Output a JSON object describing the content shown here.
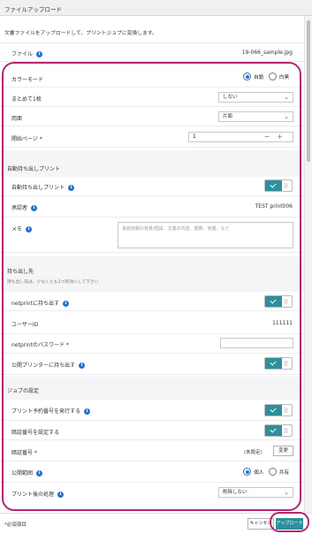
{
  "window": {
    "title": "ファイルアップロード"
  },
  "intro": "文書ファイルをアップロードして、プリントジョブに変換します。",
  "file": {
    "label": "ファイル",
    "value": "19-066_sample.jpg"
  },
  "colorMode": {
    "label": "カラーモード",
    "options": [
      "自動",
      "白黒"
    ],
    "selected": "自動"
  },
  "nup": {
    "label": "まとめて1枚",
    "value": "しない"
  },
  "duplex": {
    "label": "両面",
    "value": "片面"
  },
  "startPage": {
    "label": "開始ページ *",
    "value": "1"
  },
  "autoSection": {
    "title": "自動持ち出しプリント",
    "autoPrint": {
      "label": "自動持ち出しプリント",
      "on": true
    },
    "approver": {
      "label": "承認者",
      "value": "TEST print006"
    },
    "memo": {
      "label": "メモ",
      "placeholder": "承認依頼の背景/理由、文書の内容、部数、宛書、など"
    }
  },
  "takeoutSection": {
    "title": "持ち出し先",
    "note": "持ち出し先は、少なくとも1つ有効にして下さい",
    "netprint": {
      "label": "netprintに持ち出す",
      "on": true
    },
    "userId": {
      "label": "ユーザーID",
      "value": "111111"
    },
    "password": {
      "label": "netprintのパスワード *"
    },
    "public": {
      "label": "公開プリンターに持ち出す",
      "on": true
    }
  },
  "jobSection": {
    "title": "ジョブの設定",
    "reserve": {
      "label": "プリント予約番号を発行する",
      "on": true
    },
    "pin": {
      "label": "暗証番号を設定する",
      "on": true
    },
    "pinNumber": {
      "label": "暗証番号 *",
      "status": "(未設定)",
      "change": "変更"
    },
    "scope": {
      "label": "公開範囲",
      "options": [
        "個人",
        "共有"
      ],
      "selected": "個人"
    },
    "afterPrint": {
      "label": "プリント後の処理",
      "value": "削除しない"
    }
  },
  "footer": {
    "required": "*必須項目",
    "cancel": "キャンセル",
    "upload": "アップロード"
  },
  "colors": {
    "accent": "#2f8f9d",
    "highlight": "#b3286e",
    "info": "#2673c9"
  }
}
